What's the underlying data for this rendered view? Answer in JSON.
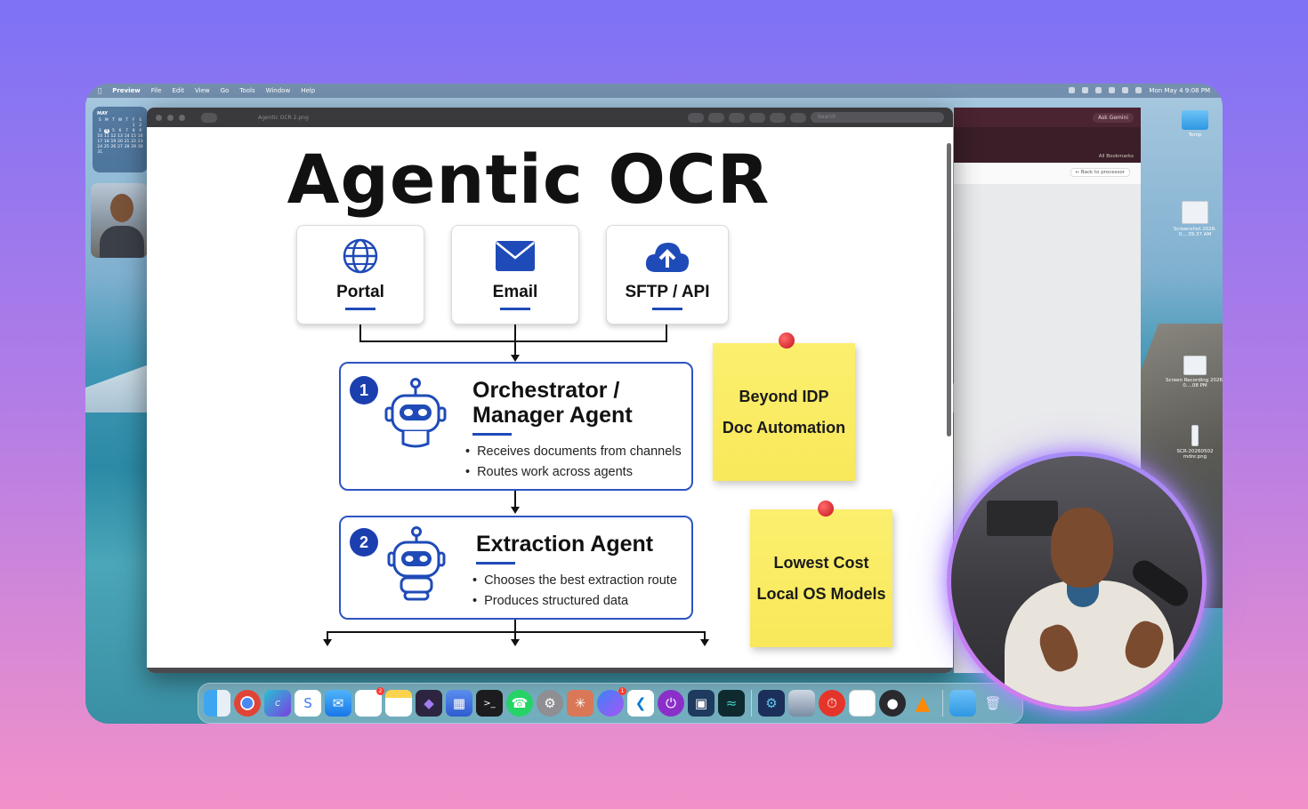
{
  "menubar": {
    "app_name": "Preview",
    "menus": [
      "File",
      "Edit",
      "View",
      "Go",
      "Tools",
      "Window",
      "Help"
    ],
    "clock": "Mon May 4  9:08 PM"
  },
  "calendar": {
    "month": "MAY",
    "weekdays": [
      "S",
      "M",
      "T",
      "W",
      "T",
      "F",
      "S"
    ],
    "days": [
      "",
      "",
      "",
      "",
      "",
      "1",
      "2",
      "3",
      "4",
      "5",
      "6",
      "7",
      "8",
      "9",
      "10",
      "11",
      "12",
      "13",
      "14",
      "15",
      "16",
      "17",
      "18",
      "19",
      "20",
      "21",
      "22",
      "23",
      "24",
      "25",
      "26",
      "27",
      "28",
      "29",
      "30",
      "31"
    ],
    "today": "4"
  },
  "desktop_icons": {
    "temp": "Temp",
    "screenshot": "Screenshot 2026-0....39.37 AM",
    "screen_recording": "Screen Recording 2026-0....08 PM",
    "scr_file": "SCR-20260502 mdnr.png"
  },
  "preview": {
    "doc_title": "Agentic OCR 2.png",
    "search_placeholder": "Search"
  },
  "slide": {
    "title": "Agentic OCR",
    "channels": [
      {
        "label": "Portal",
        "icon": "globe-icon"
      },
      {
        "label": "Email",
        "icon": "envelope-icon"
      },
      {
        "label": "SFTP / API",
        "icon": "cloud-upload-icon"
      }
    ],
    "agents": [
      {
        "number": "1",
        "title_line1": "Orchestrator /",
        "title_line2": "Manager Agent",
        "bullets": [
          "Receives documents from channels",
          "Routes work across agents"
        ]
      },
      {
        "number": "2",
        "title_line1": "Extraction Agent",
        "bullets": [
          "Chooses the best extraction route",
          "Produces structured data"
        ]
      }
    ],
    "notes": [
      {
        "line1": "Beyond IDP",
        "line2": "Doc Automation"
      },
      {
        "line1": "Lowest Cost",
        "line2": "Local OS Models"
      }
    ]
  },
  "browser": {
    "gemini_button": "Ask Gemini",
    "bookmarks": "All Bookmarks",
    "back_link": "← Back to processor"
  },
  "colors": {
    "accent_blue": "#1f4bb8",
    "sticky_yellow": "#f8e85a",
    "pin_red": "#c4121c"
  },
  "dock_apps": [
    "Finder",
    "Chrome",
    "Canva",
    "Signal",
    "Mail",
    "Reminders",
    "Notes",
    "Obsidian",
    "Preview",
    "Terminal",
    "WhatsApp",
    "System Settings",
    "Claude",
    "Messenger",
    "VS Code",
    "Power",
    "Screen",
    "Perplexity",
    "Xcode Simulator",
    "Disk Utility",
    "Timer",
    "TextEdit",
    "OBS",
    "VLC",
    "Downloads",
    "Trash"
  ]
}
